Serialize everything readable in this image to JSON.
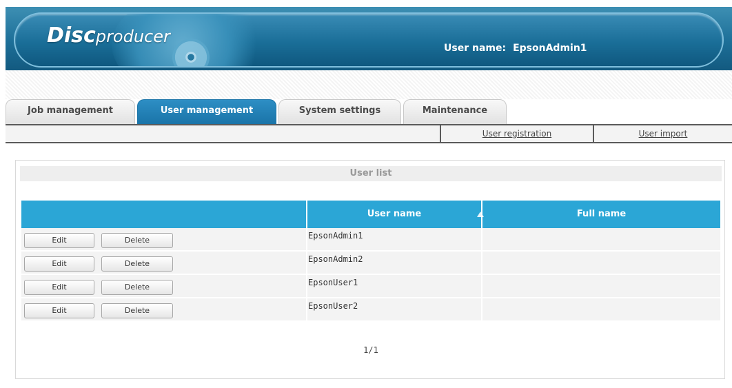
{
  "header": {
    "logo_disc": "Disc",
    "logo_producer": "producer",
    "user_label": "User name:",
    "user_value": "EpsonAdmin1"
  },
  "tabs": [
    {
      "label": "Job management",
      "active": false
    },
    {
      "label": "User management",
      "active": true
    },
    {
      "label": "System settings",
      "active": false
    },
    {
      "label": "Maintenance",
      "active": false
    }
  ],
  "subnav": {
    "user_registration": "User registration",
    "user_import": "User import"
  },
  "panel": {
    "title": "User list",
    "columns": {
      "user_name": "User name",
      "full_name": "Full name"
    },
    "sort": {
      "column": "User name",
      "direction": "ascending"
    },
    "edit_label": "Edit",
    "delete_label": "Delete",
    "rows": [
      {
        "user_name": "EpsonAdmin1",
        "full_name": ""
      },
      {
        "user_name": "EpsonAdmin2",
        "full_name": ""
      },
      {
        "user_name": "EpsonUser1",
        "full_name": ""
      },
      {
        "user_name": "EpsonUser2",
        "full_name": ""
      }
    ],
    "pager": "1/1"
  },
  "colors": {
    "header_blue": "#1d6f98",
    "active_tab": "#1a74a8",
    "grid_header": "#2ba6d6",
    "row_bg": "#f3f3f3"
  }
}
